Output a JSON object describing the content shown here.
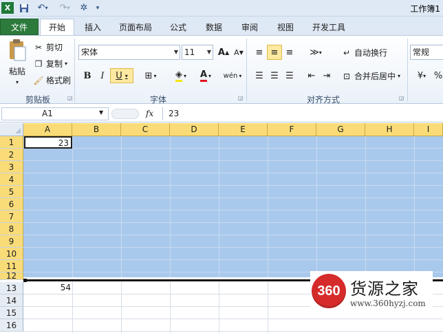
{
  "title_bar": {
    "doc_title": "工作簿1"
  },
  "tabs": [
    {
      "label": "文件"
    },
    {
      "label": "开始"
    },
    {
      "label": "插入"
    },
    {
      "label": "页面布局"
    },
    {
      "label": "公式"
    },
    {
      "label": "数据"
    },
    {
      "label": "审阅"
    },
    {
      "label": "视图"
    },
    {
      "label": "开发工具"
    }
  ],
  "clipboard": {
    "paste": "粘贴",
    "cut": "剪切",
    "copy": "复制",
    "format_painter": "格式刷",
    "group_label": "剪贴板"
  },
  "font": {
    "name": "宋体",
    "size": "11",
    "bold": "B",
    "italic": "I",
    "underline": "U",
    "group_label": "字体",
    "grow": "A",
    "shrink": "A",
    "font_color": "A",
    "phonetic": "wén"
  },
  "alignment": {
    "wrap_text": "自动换行",
    "merge_center": "合并后居中",
    "group_label": "对齐方式"
  },
  "number": {
    "format": "常规"
  },
  "formula_bar": {
    "name_box": "A1",
    "fx": "fx",
    "value": "23"
  },
  "columns": [
    "A",
    "B",
    "C",
    "D",
    "E",
    "F",
    "G",
    "H",
    "I"
  ],
  "rows": [
    "1",
    "2",
    "3",
    "4",
    "5",
    "6",
    "7",
    "8",
    "9",
    "10",
    "11",
    "12",
    "13",
    "14",
    "15",
    "16"
  ],
  "cells": {
    "A1": "23",
    "A13": "54"
  },
  "watermark": {
    "badge": "360",
    "title": "货源之家",
    "url": "www.360hyzj.com"
  },
  "colors": {
    "selection": "#a9c9ec",
    "header_highlight": "#f9dc78",
    "file_tab": "#2d7b3c"
  }
}
